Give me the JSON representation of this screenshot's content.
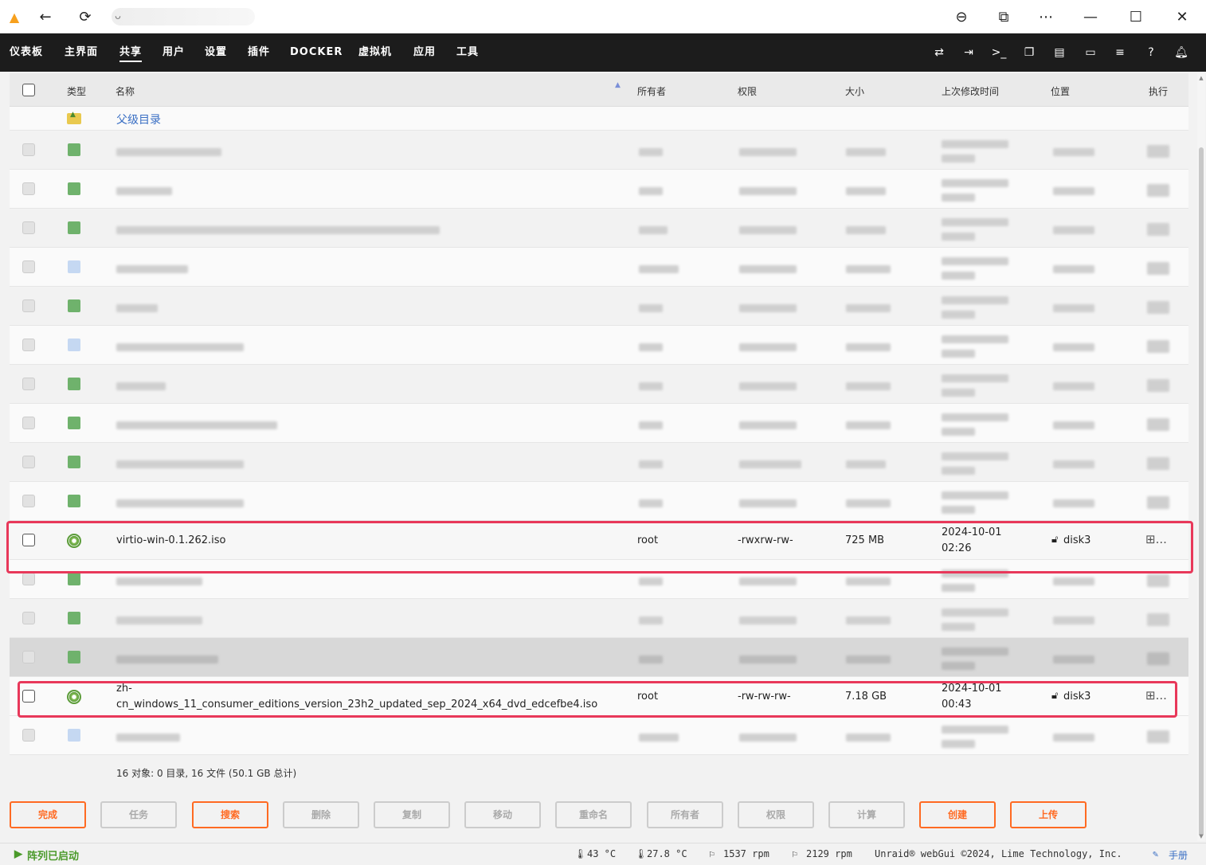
{
  "titlebar": {
    "url_text": "ᴗ",
    "icons": {
      "logo": "unraid-logo-icon",
      "back": "back-arrow-icon",
      "reload": "reload-icon",
      "zoom": "zoom-icon",
      "reader": "reader-mode-icon",
      "more": "more-icon",
      "minimize": "minimize-icon",
      "maximize": "maximize-icon",
      "close": "close-icon"
    }
  },
  "nav": {
    "items": [
      "仪表板",
      "主界面",
      "共享",
      "用户",
      "设置",
      "插件",
      "DOCKER",
      "虚拟机",
      "应用",
      "工具"
    ],
    "active_index": 2
  },
  "table": {
    "headers": {
      "type": "类型",
      "name": "名称",
      "owner": "所有者",
      "permissions": "权限",
      "size": "大小",
      "modified": "上次修改时间",
      "location": "位置",
      "action": "执行"
    },
    "parent_dir": "父级目录",
    "rows": [
      {
        "name": "virtio-win-0.1.262.iso",
        "owner": "root",
        "permissions": "-rwxrw-rw-",
        "size": "725 MB",
        "date": "2024-10-01",
        "time": "02:26",
        "location": "disk3",
        "action": "⊞..."
      },
      {
        "name_line1": "zh-",
        "name_line2": "cn_windows_11_consumer_editions_version_23h2_updated_sep_2024_x64_dvd_edcefbe4.iso",
        "owner": "root",
        "permissions": "-rw-rw-rw-",
        "size": "7.18 GB",
        "date": "2024-10-01",
        "time": "00:43",
        "location": "disk3",
        "action": "⊞..."
      }
    ]
  },
  "summary": "16 对象: 0 目录, 16 文件 (50.1 GB 总计)",
  "buttons": [
    "完成",
    "任务",
    "搜索",
    "删除",
    "复制",
    "移动",
    "重命名",
    "所有者",
    "权限",
    "计算",
    "创建",
    "上传"
  ],
  "status": {
    "array": "阵列已启动",
    "temp1": "43 °C",
    "temp2": "27.8 °C",
    "fan1": "1537 rpm",
    "fan2": "2129 rpm",
    "copyright": "Unraid® webGui ©2024, Lime Technology, Inc.",
    "manual": "手册"
  },
  "colors": {
    "accent": "#ff6a22",
    "highlight": "#e8385a",
    "nav_bg": "#1c1c1c",
    "ok_green": "#4a9a2a"
  }
}
